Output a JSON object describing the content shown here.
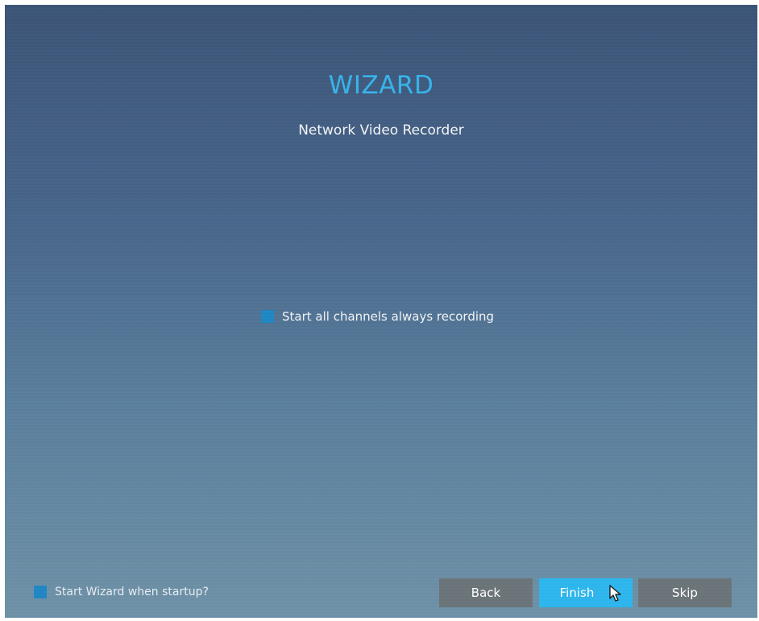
{
  "wizard": {
    "title": "WIZARD",
    "subtitle": "Network Video Recorder",
    "title_color": "#36b4ec"
  },
  "options": {
    "always_recording_label": "Start all channels always recording",
    "always_recording_checked": false,
    "startup_label": "Start Wizard when startup?",
    "startup_checked": false,
    "checkbox_color": "#1f87c4"
  },
  "buttons": {
    "back_label": "Back",
    "finish_label": "Finish",
    "skip_label": "Skip",
    "default_color": "#6b7479",
    "active_color": "#2cb6ee"
  },
  "icons": {
    "cursor": "mouse-pointer-icon"
  }
}
